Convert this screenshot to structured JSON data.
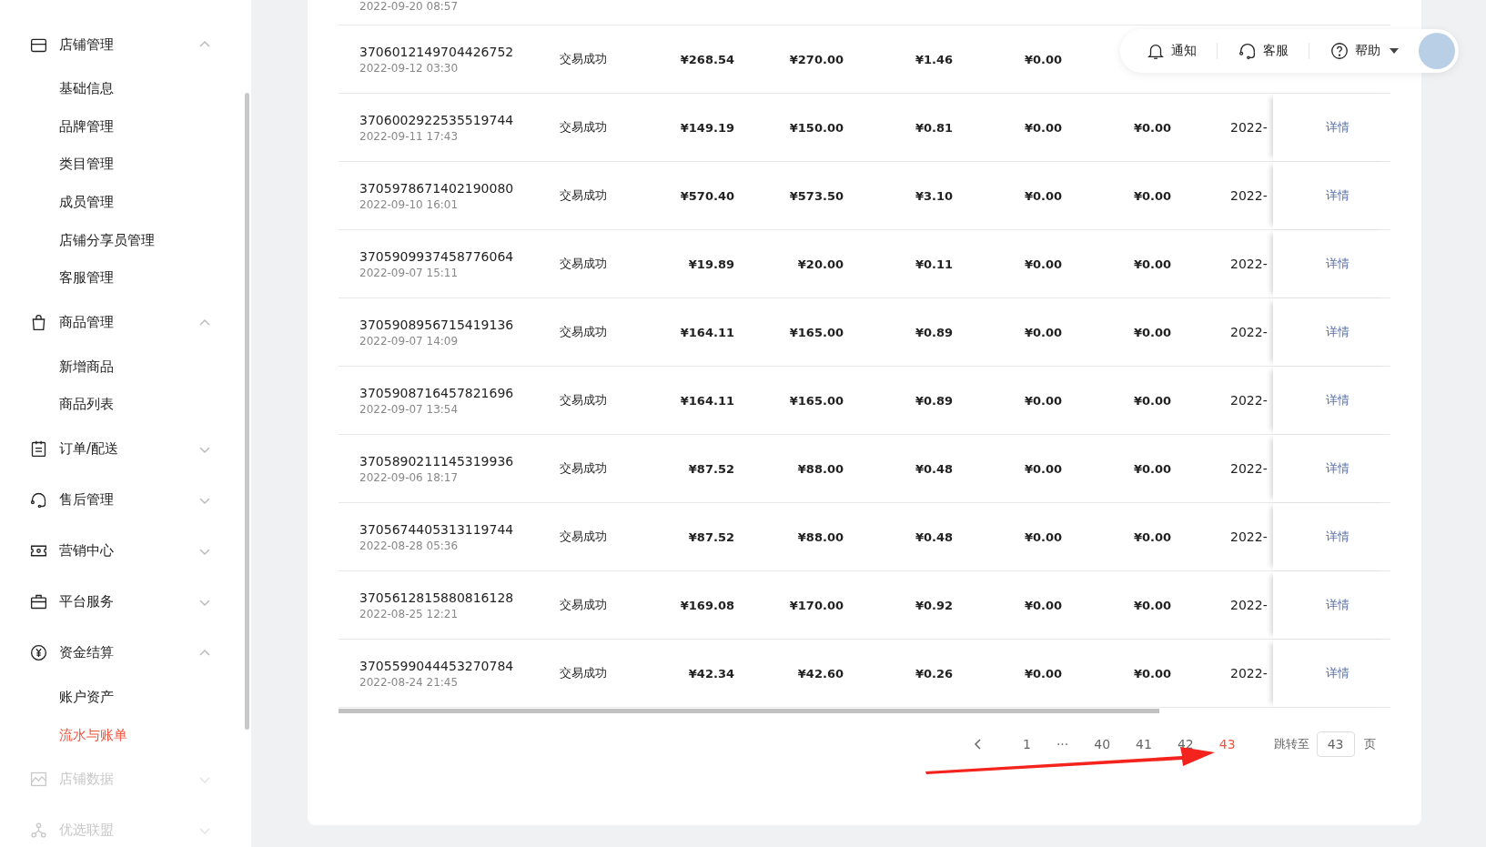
{
  "sidebar": {
    "groups": [
      {
        "label": "店铺管理",
        "kind": "store",
        "expanded": true,
        "disabled": false,
        "children": [
          {
            "label": "基础信息",
            "selected": false
          },
          {
            "label": "品牌管理",
            "selected": false
          },
          {
            "label": "类目管理",
            "selected": false
          },
          {
            "label": "成员管理",
            "selected": false
          },
          {
            "label": "店铺分享员管理",
            "selected": false
          },
          {
            "label": "客服管理",
            "selected": false
          }
        ]
      },
      {
        "label": "商品管理",
        "kind": "bag",
        "expanded": true,
        "disabled": false,
        "children": [
          {
            "label": "新增商品",
            "selected": false
          },
          {
            "label": "商品列表",
            "selected": false
          }
        ]
      },
      {
        "label": "订单/配送",
        "kind": "clipboard",
        "expanded": false,
        "disabled": false
      },
      {
        "label": "售后管理",
        "kind": "headset",
        "expanded": false,
        "disabled": false
      },
      {
        "label": "营销中心",
        "kind": "ticket",
        "expanded": false,
        "disabled": false
      },
      {
        "label": "平台服务",
        "kind": "briefcase",
        "expanded": false,
        "disabled": false
      },
      {
        "label": "资金结算",
        "kind": "yen",
        "expanded": true,
        "disabled": false,
        "children": [
          {
            "label": "账户资产",
            "selected": false
          },
          {
            "label": "流水与账单",
            "selected": true
          }
        ]
      },
      {
        "label": "店铺数据",
        "kind": "chart",
        "expanded": false,
        "disabled": true
      },
      {
        "label": "优选联盟",
        "kind": "network",
        "expanded": false,
        "disabled": true
      }
    ]
  },
  "header": {
    "items": [
      {
        "label": "通知",
        "kind": "bell",
        "dropdown": false
      },
      {
        "label": "客服",
        "kind": "headset",
        "dropdown": false
      },
      {
        "label": "帮助",
        "kind": "help",
        "dropdown": true
      }
    ]
  },
  "table": {
    "partial_row": {
      "time": "2022-09-20 08:57"
    },
    "rows": [
      {
        "order_id": "3706012149704426752",
        "time": "2022-09-12 03:30",
        "status": "交易成功",
        "amounts": [
          "¥268.54",
          "¥270.00",
          "¥1.46",
          "¥0.00"
        ]
      },
      {
        "order_id": "3706002922535519744",
        "time": "2022-09-11 17:43",
        "status": "交易成功",
        "amounts": [
          "¥149.19",
          "¥150.00",
          "¥0.81",
          "¥0.00",
          "¥0.00"
        ],
        "column_8": "2022-",
        "action": "详情"
      },
      {
        "order_id": "3705978671402190080",
        "time": "2022-09-10 16:01",
        "status": "交易成功",
        "amounts": [
          "¥570.40",
          "¥573.50",
          "¥3.10",
          "¥0.00",
          "¥0.00"
        ],
        "column_8": "2022-",
        "action": "详情"
      },
      {
        "order_id": "3705909937458776064",
        "time": "2022-09-07 15:11",
        "status": "交易成功",
        "amounts": [
          "¥19.89",
          "¥20.00",
          "¥0.11",
          "¥0.00",
          "¥0.00"
        ],
        "column_8": "2022-",
        "action": "详情"
      },
      {
        "order_id": "3705908956715419136",
        "time": "2022-09-07 14:09",
        "status": "交易成功",
        "amounts": [
          "¥164.11",
          "¥165.00",
          "¥0.89",
          "¥0.00",
          "¥0.00"
        ],
        "column_8": "2022-",
        "action": "详情"
      },
      {
        "order_id": "3705908716457821696",
        "time": "2022-09-07 13:54",
        "status": "交易成功",
        "amounts": [
          "¥164.11",
          "¥165.00",
          "¥0.89",
          "¥0.00",
          "¥0.00"
        ],
        "column_8": "2022-",
        "action": "详情"
      },
      {
        "order_id": "3705890211145319936",
        "time": "2022-09-06 18:17",
        "status": "交易成功",
        "amounts": [
          "¥87.52",
          "¥88.00",
          "¥0.48",
          "¥0.00",
          "¥0.00"
        ],
        "column_8": "2022-",
        "action": "详情"
      },
      {
        "order_id": "3705674405313119744",
        "time": "2022-08-28 05:36",
        "status": "交易成功",
        "amounts": [
          "¥87.52",
          "¥88.00",
          "¥0.48",
          "¥0.00",
          "¥0.00"
        ],
        "column_8": "2022-",
        "action": "详情"
      },
      {
        "order_id": "3705612815880816128",
        "time": "2022-08-25 12:21",
        "status": "交易成功",
        "amounts": [
          "¥169.08",
          "¥170.00",
          "¥0.92",
          "¥0.00",
          "¥0.00"
        ],
        "column_8": "2022-",
        "action": "详情"
      },
      {
        "order_id": "3705599044453270784",
        "time": "2022-08-24 21:45",
        "status": "交易成功",
        "amounts": [
          "¥42.34",
          "¥42.60",
          "¥0.26",
          "¥0.00",
          "¥0.00"
        ],
        "column_8": "2022-",
        "action": "详情"
      }
    ]
  },
  "pagination": {
    "pages": [
      {
        "label": "1",
        "selected": false
      },
      {
        "label": "···",
        "selected": false
      },
      {
        "label": "40",
        "selected": false
      },
      {
        "label": "41",
        "selected": false
      },
      {
        "label": "42",
        "selected": false
      },
      {
        "label": "43",
        "selected": true
      }
    ],
    "jump_label": "跳转至",
    "jump_value": "43",
    "page_suffix": "页"
  }
}
